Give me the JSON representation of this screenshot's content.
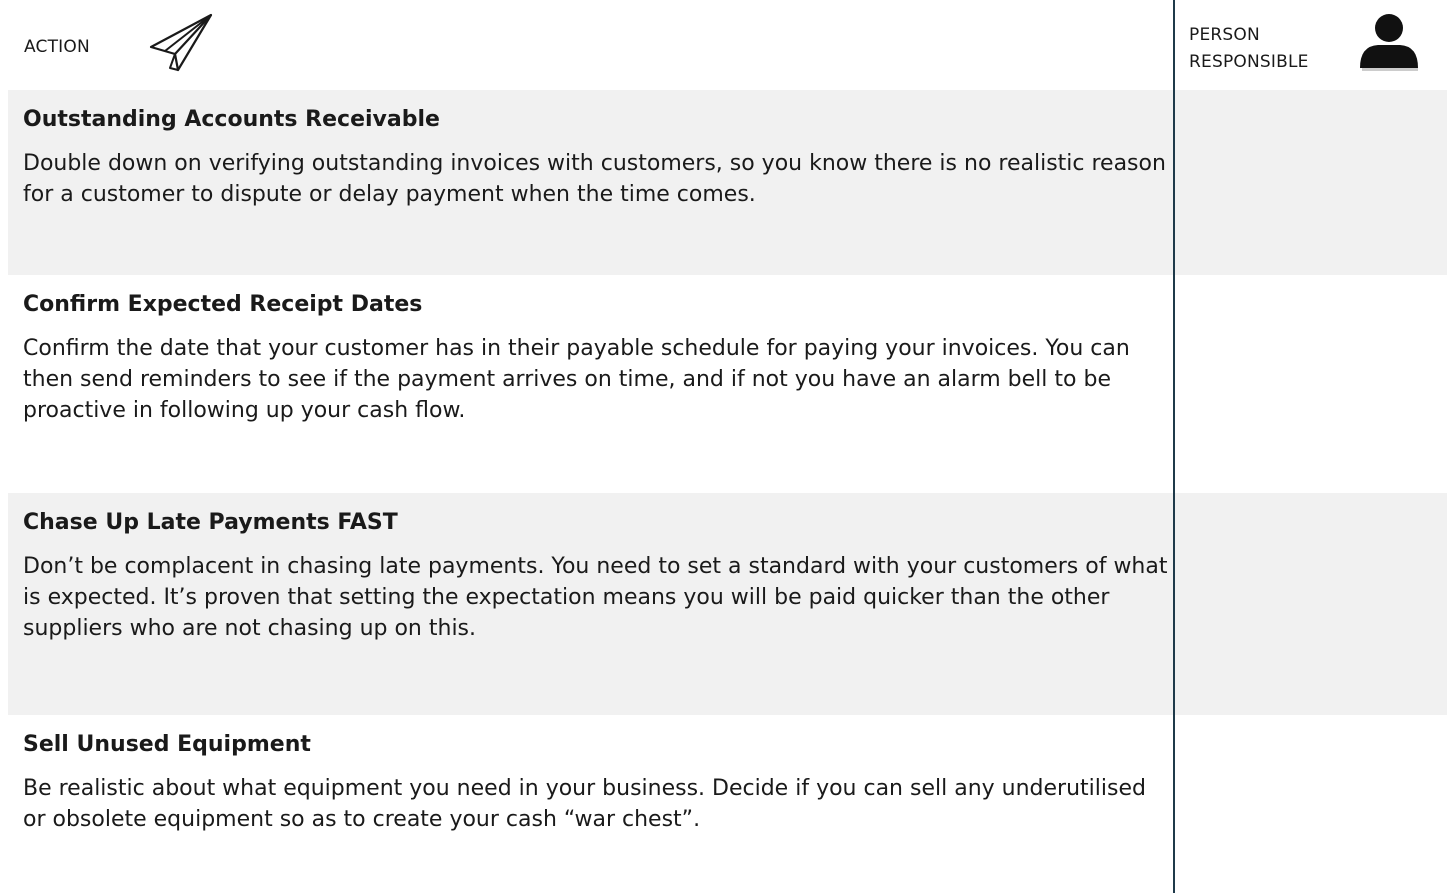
{
  "header": {
    "action_label": "ACTION",
    "person_label_line1": "PERSON",
    "person_label_line2": "RESPONSIBLE"
  },
  "icons": {
    "action": "paper-plane-icon",
    "person": "person-icon"
  },
  "colors": {
    "row_shade": "#f1f1f1",
    "divider": "#1f3a4a"
  },
  "rows": [
    {
      "title": "Outstanding Accounts Receivable",
      "body": "Double down on verifying outstanding invoices with customers, so you know there is no realistic reason for a customer to dispute or delay payment when the time comes."
    },
    {
      "title": "Confirm Expected Receipt Dates",
      "body": "Confirm the date that your customer has in their payable schedule for paying your invoices. You can then send reminders to see if the payment arrives on time, and if not you have an alarm bell to be proactive in following up your cash flow."
    },
    {
      "title": "Chase Up Late Payments FAST",
      "body": "Don’t be complacent in chasing late payments. You need to set a standard with your customers of what is expected. It’s proven that setting the expectation means you will be paid quicker than the other suppliers who are not chasing up on this."
    },
    {
      "title": "Sell Unused Equipment",
      "body": "Be realistic about what equipment you need in your business. Decide if you can sell any underutilised or obsolete equipment so as to create your cash “war chest”."
    }
  ]
}
